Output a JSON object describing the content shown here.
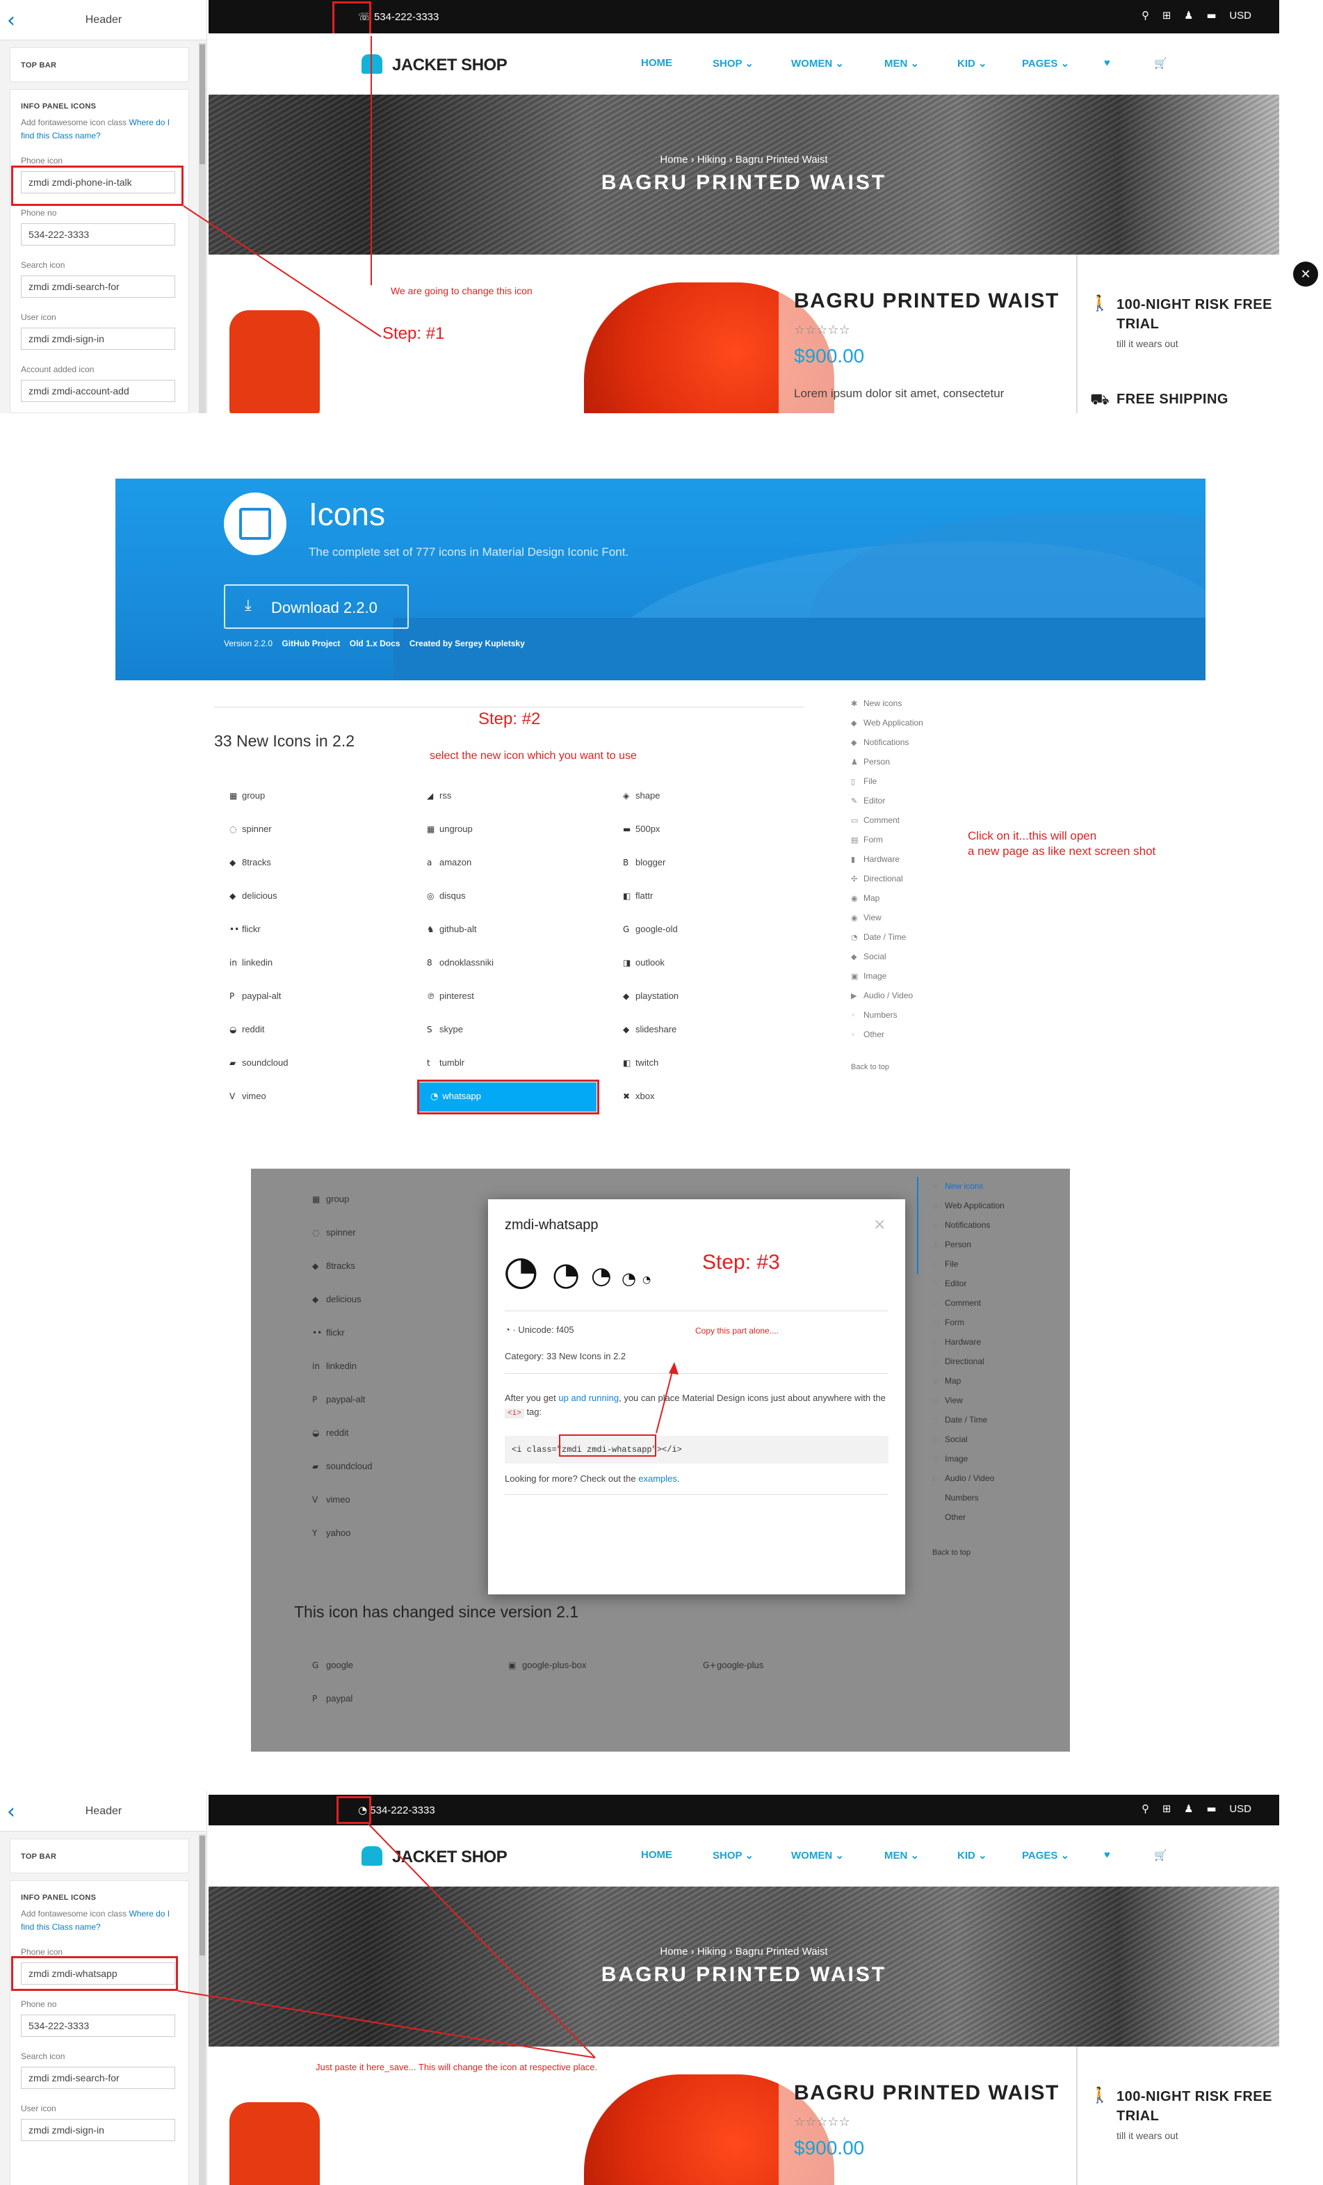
{
  "customizer1": {
    "back": "‹",
    "title": "Header",
    "top_bar": "TOP BAR",
    "info_heading": "INFO PANEL ICONS",
    "info_desc": "Add fontawesome icon class",
    "info_link": "Where do I find this Class name?",
    "fields": [
      {
        "label": "Phone icon",
        "value": "zmdi zmdi-phone-in-talk"
      },
      {
        "label": "Phone no",
        "value": "534-222-3333"
      },
      {
        "label": "Search icon",
        "value": "zmdi zmdi-search-for"
      },
      {
        "label": "User icon",
        "value": "zmdi zmdi-sign-in"
      },
      {
        "label": "Account added icon",
        "value": "zmdi zmdi-account-add"
      }
    ]
  },
  "customizer2": {
    "back": "‹",
    "title": "Header",
    "top_bar": "TOP BAR",
    "info_heading": "INFO PANEL ICONS",
    "info_desc": "Add fontawesome icon class",
    "info_link": "Where do I find this Class name?",
    "fields": [
      {
        "label": "Phone icon",
        "value": "zmdi zmdi-whatsapp"
      },
      {
        "label": "Phone no",
        "value": "534-222-3333"
      },
      {
        "label": "Search icon",
        "value": "zmdi zmdi-search-for"
      },
      {
        "label": "User icon",
        "value": "zmdi zmdi-sign-in"
      }
    ]
  },
  "shop": {
    "phone1_icon": "☏",
    "phone2_icon": "◔",
    "phone": "534-222-3333",
    "topbar_icons": "⚲ ⊞ ♟ ▬",
    "currency": "USD",
    "logo": "JACKET SHOP",
    "menu": [
      "HOME",
      "SHOP ⌄",
      "WOMEN ⌄",
      "MEN ⌄",
      "KID ⌄",
      "PAGES ⌄",
      "♥",
      "🛒"
    ],
    "breadcrumb": "Home › Hiking › Bagru Printed Waist",
    "hero_title": "BAGRU PRINTED WAIST",
    "product_name": "BAGRU PRINTED WAIST",
    "stars": "☆☆☆☆☆",
    "price": "$900.00",
    "lorem": "Lorem ipsum dolor sit amet, consectetur",
    "feature1_title": "100-NIGHT RISK FREE TRIAL",
    "feature1_sub": "till it wears out",
    "feature2_title": "FREE SHIPPING",
    "walk_icon": "🚶",
    "truck_icon": "⛟",
    "close": "✕",
    "arrow": "◂"
  },
  "annotations": {
    "note1": "We are going to change this icon",
    "step1": "Step: #1",
    "step2": "Step: #2",
    "note2": "select the new icon which you want to use",
    "note3_l1": "Click on it...this will open",
    "note3_l2": "a new page as like next screen shot",
    "step3": "Step: #3",
    "note4": "Copy this part alone....",
    "note5": "Just paste it here_save... This will change the icon at respective place."
  },
  "icons_page": {
    "title": "Icons",
    "subtitle": "The complete set of 777 icons in Material Design Iconic Font.",
    "download_icon": "⤓",
    "download": "Download 2.2.0",
    "version": "Version 2.2.0",
    "links": [
      "GitHub Project",
      "Old 1.x Docs",
      "Created by Sergey Kupletsky"
    ],
    "section": "33 New Icons in 2.2",
    "icons": [
      {
        "g": "▦",
        "n": "group"
      },
      {
        "g": "◢",
        "n": "rss"
      },
      {
        "g": "◈",
        "n": "shape"
      },
      {
        "g": "◌",
        "n": "spinner"
      },
      {
        "g": "▦",
        "n": "ungroup"
      },
      {
        "g": "▬",
        "n": "500px"
      },
      {
        "g": "◆",
        "n": "8tracks"
      },
      {
        "g": "a",
        "n": "amazon"
      },
      {
        "g": "B",
        "n": "blogger"
      },
      {
        "g": "◆",
        "n": "delicious"
      },
      {
        "g": "◎",
        "n": "disqus"
      },
      {
        "g": "◧",
        "n": "flattr"
      },
      {
        "g": "••",
        "n": "flickr"
      },
      {
        "g": "♞",
        "n": "github-alt"
      },
      {
        "g": "G",
        "n": "google-old"
      },
      {
        "g": "in",
        "n": "linkedin"
      },
      {
        "g": "8",
        "n": "odnoklassniki"
      },
      {
        "g": "◨",
        "n": "outlook"
      },
      {
        "g": "P",
        "n": "paypal-alt"
      },
      {
        "g": "℗",
        "n": "pinterest"
      },
      {
        "g": "◆",
        "n": "playstation"
      },
      {
        "g": "◒",
        "n": "reddit"
      },
      {
        "g": "S",
        "n": "skype"
      },
      {
        "g": "◆",
        "n": "slideshare"
      },
      {
        "g": "▰",
        "n": "soundcloud"
      },
      {
        "g": "t",
        "n": "tumblr"
      },
      {
        "g": "◧",
        "n": "twitch"
      },
      {
        "g": "V",
        "n": "vimeo"
      },
      {
        "g": "◔",
        "n": "whatsapp"
      },
      {
        "g": "✖",
        "n": "xbox"
      }
    ],
    "sidenav": [
      {
        "g": "✱",
        "n": "New icons"
      },
      {
        "g": "◆",
        "n": "Web Application"
      },
      {
        "g": "◆",
        "n": "Notifications"
      },
      {
        "g": "♟",
        "n": "Person"
      },
      {
        "g": "▯",
        "n": "File"
      },
      {
        "g": "✎",
        "n": "Editor"
      },
      {
        "g": "▭",
        "n": "Comment"
      },
      {
        "g": "▤",
        "n": "Form"
      },
      {
        "g": "▮",
        "n": "Hardware"
      },
      {
        "g": "✣",
        "n": "Directional"
      },
      {
        "g": "◉",
        "n": "Map"
      },
      {
        "g": "◉",
        "n": "View"
      },
      {
        "g": "◔",
        "n": "Date / Time"
      },
      {
        "g": "◆",
        "n": "Social"
      },
      {
        "g": "▣",
        "n": "Image"
      },
      {
        "g": "▶",
        "n": "Audio / Video"
      },
      {
        "g": "◦",
        "n": "Numbers"
      },
      {
        "g": "◦",
        "n": "Other"
      }
    ],
    "back_to_top": "Back to top"
  },
  "modal_page": {
    "bg_icons": [
      {
        "g": "▦",
        "n": "group"
      },
      {
        "g": "◌",
        "n": "spinner"
      },
      {
        "g": "◆",
        "n": "8tracks"
      },
      {
        "g": "◆",
        "n": "delicious"
      },
      {
        "g": "••",
        "n": "flickr"
      },
      {
        "g": "in",
        "n": "linkedin"
      },
      {
        "g": "P",
        "n": "paypal-alt"
      },
      {
        "g": "◒",
        "n": "reddit"
      },
      {
        "g": "▰",
        "n": "soundcloud"
      },
      {
        "g": "V",
        "n": "vimeo"
      },
      {
        "g": "Y",
        "n": "yahoo"
      }
    ],
    "changed_title": "This icon has changed since version 2.1",
    "changed_icons": [
      {
        "g": "G",
        "n": "google"
      },
      {
        "g": "▣",
        "n": "google-plus-box"
      },
      {
        "g": "G+",
        "n": "google-plus"
      },
      {
        "g": "P",
        "n": "paypal"
      }
    ],
    "modal_title": "zmdi-whatsapp",
    "wa_glyph": "◔",
    "close": "×",
    "unicode": "◔ · Unicode: f405",
    "category": "Category: 33 New Icons in 2.2",
    "para1_a": "After you get",
    "para1_link": "up and running",
    "para1_b": ", you can place Material Design icons just about anywhere",
    "para2_a": "with the",
    "para2_tag": "<i>",
    "para2_b": "tag:",
    "code_a": "<i class=\"",
    "code_sel": "zmdi zmdi-whatsapp",
    "code_b": "\"></i>",
    "more_a": "Looking for more? Check out the",
    "more_link": "examples",
    "more_b": "."
  }
}
